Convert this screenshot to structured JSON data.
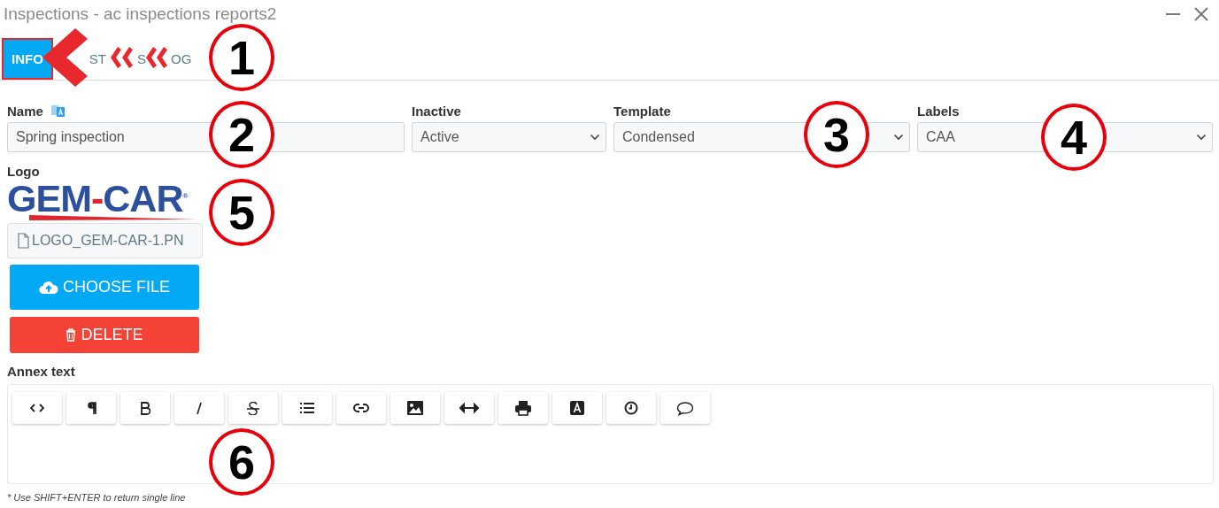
{
  "window": {
    "title": "Inspections - ac inspections reports2"
  },
  "tabs": [
    {
      "label": "INFO",
      "selected": true
    },
    {
      "label": "ST",
      "selected": false
    },
    {
      "label": "S",
      "selected": false
    },
    {
      "label": "OG",
      "selected": false
    }
  ],
  "fields": [
    {
      "label": "Name",
      "kind": "text",
      "value": "Spring inspection",
      "translatable": true
    },
    {
      "label": "Inactive",
      "kind": "select",
      "value": "Active"
    },
    {
      "label": "Template",
      "kind": "select",
      "value": "Condensed"
    },
    {
      "label": "Labels",
      "kind": "select",
      "value": "CAA"
    }
  ],
  "logo": {
    "label": "Logo",
    "parts": [
      {
        "text": "GEM",
        "color": "#2c4f9e"
      },
      {
        "text": "-",
        "color": "#e3242b"
      },
      {
        "text": "CAR$^{®}$",
        "color": "#2c4f9e"
      }
    ],
    "file_name": "LOGO_GEM-CAR-1.PN",
    "choose_button": "CHOOSE FILE",
    "delete_button": "DELETE"
  },
  "annex": {
    "label": "Annex text",
    "toolbar": [
      {
        "kind": "code"
      },
      {
        "kind": "paragraph"
      },
      {
        "kind": "bold"
      },
      {
        "kind": "italic"
      },
      {
        "kind": "strike"
      },
      {
        "kind": "list"
      },
      {
        "kind": "link"
      },
      {
        "kind": "image"
      },
      {
        "kind": "rule"
      },
      {
        "kind": "print"
      },
      {
        "kind": "font"
      },
      {
        "kind": "clock"
      },
      {
        "kind": "comment"
      }
    ],
    "hint": "* Use SHIFT+ENTER to return single line"
  },
  "annotations": [
    {
      "number": "1"
    },
    {
      "number": "2"
    },
    {
      "number": "3"
    },
    {
      "number": "4"
    },
    {
      "number": "5"
    },
    {
      "number": "6"
    }
  ]
}
